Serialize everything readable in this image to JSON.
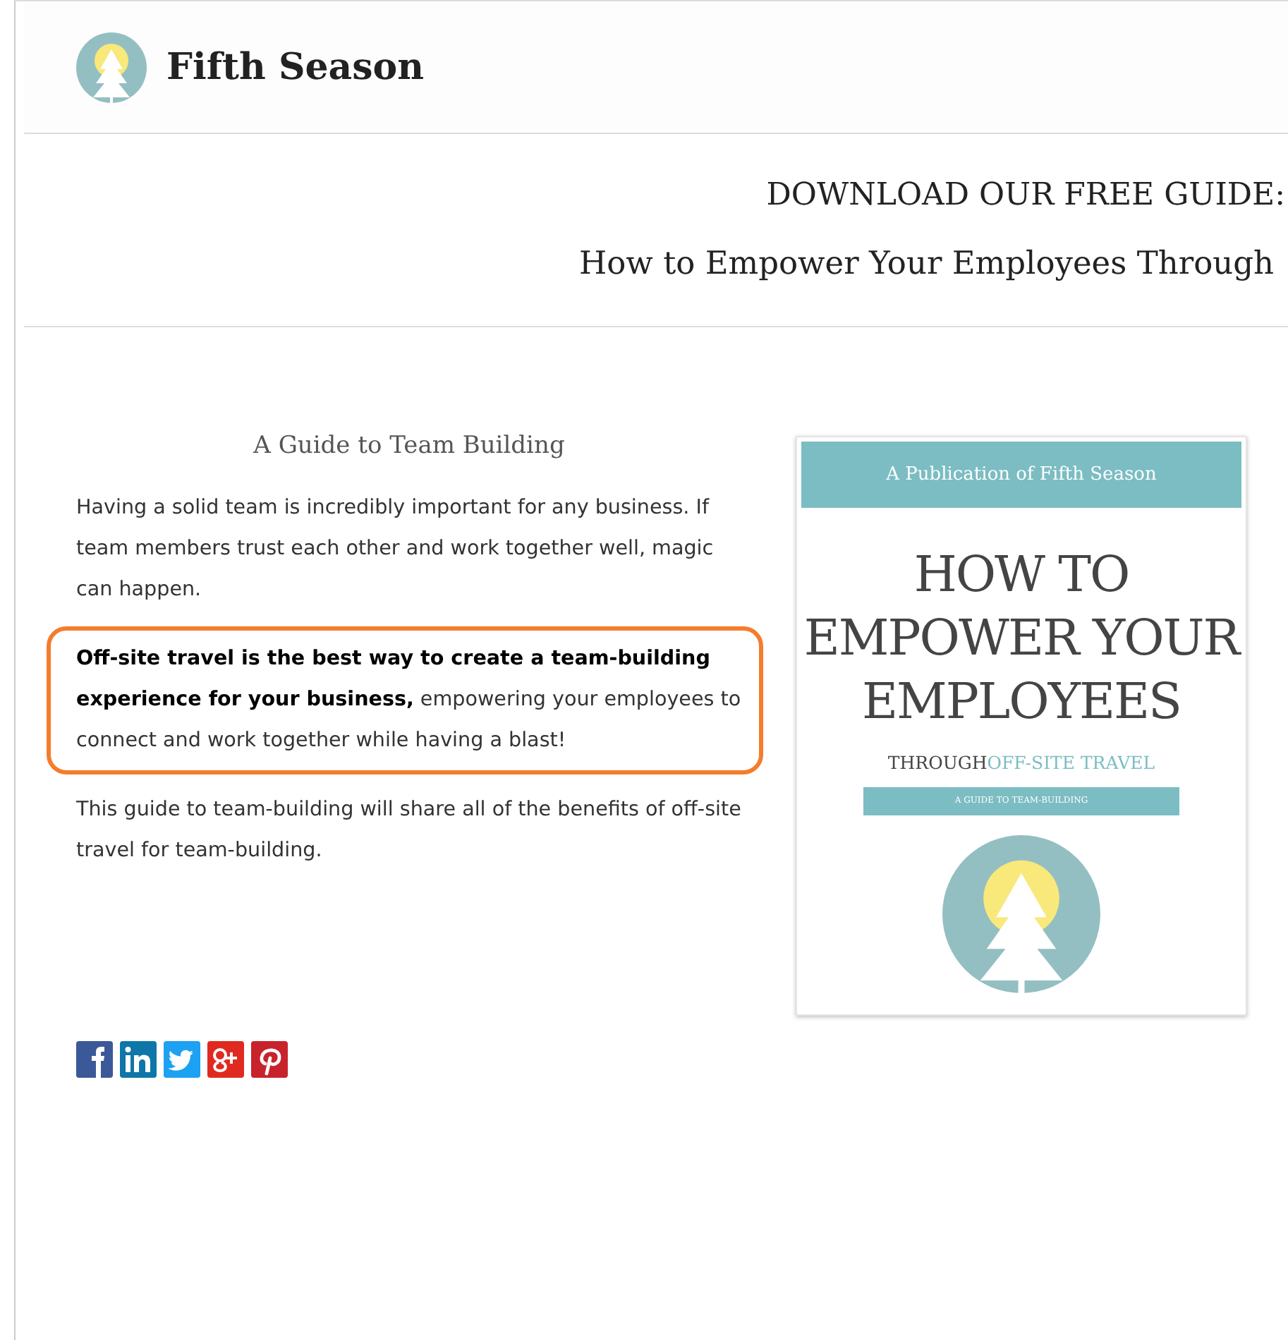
{
  "header": {
    "brand": "Fifth Season"
  },
  "banner": {
    "title": "DOWNLOAD OUR FREE GUIDE:",
    "subtitle": "How to Empower Your Employees Through"
  },
  "guide": {
    "heading": "A Guide to Team Building",
    "paragraphs": [
      {
        "text": "Having a solid team is incredibly important for any business.  If team members trust each other and work together well, magic can happen.",
        "highlighted": false
      },
      {
        "text": "**Off-site travel is the best way to create a team-building experience for your business,** empowering your employees to connect and work together while having a blast!",
        "highlighted": true
      },
      {
        "text": "This guide to team-building will share all of the benefits of off-site travel for team-building.",
        "highlighted": false
      }
    ]
  },
  "cover": {
    "publisher": "A Publication of Fifth Season",
    "title_lines": [
      "HOW TO",
      "EMPOWER YOUR",
      "EMPLOYEES"
    ],
    "through": "THROUGH",
    "highlight": "OFF-SITE TRAVEL",
    "ribbon": "A GUIDE TO TEAM-BUILDING"
  },
  "share": [
    {
      "kind": "facebook"
    },
    {
      "kind": "linkedin"
    },
    {
      "kind": "twitter"
    },
    {
      "kind": "googleplus"
    },
    {
      "kind": "pinterest"
    }
  ]
}
